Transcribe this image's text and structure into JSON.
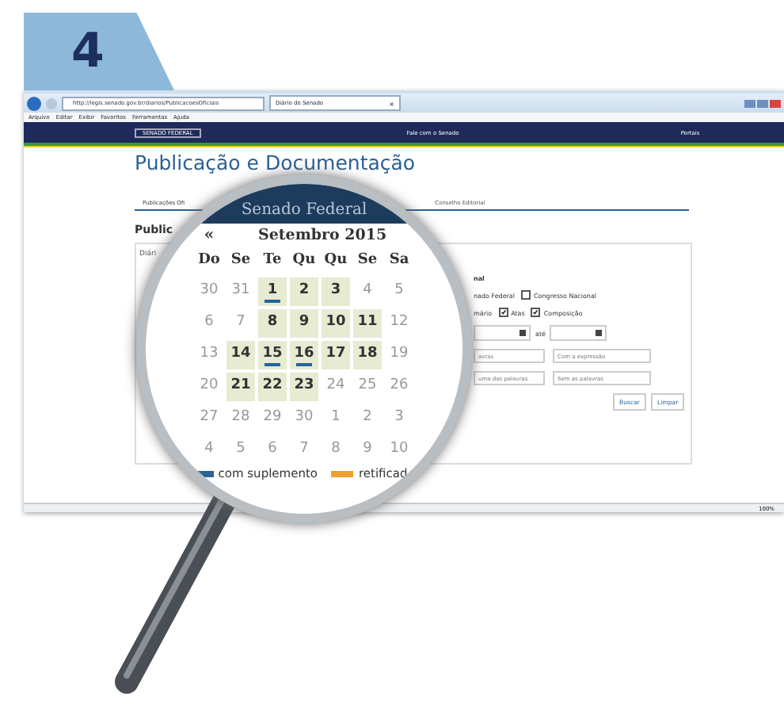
{
  "step": {
    "number": "4"
  },
  "browser": {
    "address": "http://legis.senado.gov.br/diarios/PublicacoesOficiais",
    "tab": {
      "title": "Diário do Senado",
      "close": "×"
    },
    "menu": [
      "Arquivo",
      "Editar",
      "Exibir",
      "Favoritos",
      "Ferramentas",
      "Ajuda"
    ],
    "zoom": "100%"
  },
  "site_header": {
    "brand": "SENADO FEDERAL",
    "contact": "Fale com o Senado",
    "portals": "Portais"
  },
  "page": {
    "title": "Publicação e Documentação",
    "nav": [
      {
        "label": "Publicações Ofi",
        "selected": true
      },
      {
        "label": "Conselho Editorial",
        "selected": false
      }
    ],
    "heading": "Public",
    "panel_title": "Diári",
    "form": {
      "group_label": "nal",
      "checkbox_rows": [
        [
          {
            "label": "nado Federal",
            "kind": "text"
          },
          {
            "label": "Congresso Nacional",
            "kind": "checkbox",
            "checked": false
          }
        ],
        [
          {
            "label": "mário",
            "kind": "text"
          },
          {
            "label": "Atas",
            "kind": "checkbox",
            "checked": true
          },
          {
            "label": "Composição",
            "kind": "checkbox",
            "checked": true
          }
        ]
      ],
      "date_separator": "até",
      "text_fields": [
        [
          {
            "placeholder": "avras"
          },
          {
            "placeholder": "Com a expressão"
          }
        ],
        [
          {
            "placeholder": "uma das palavras"
          },
          {
            "placeholder": "Sem as palavras"
          }
        ]
      ],
      "buttons": [
        "Buscar",
        "Limpar"
      ]
    }
  },
  "magnifier": {
    "band": "Senado Federal",
    "prev": "«",
    "month": "Setembro 2015",
    "weekdays": [
      "Do",
      "Se",
      "Te",
      "Qu",
      "Qu",
      "Se",
      "Sa"
    ],
    "weeks": [
      [
        {
          "day": "30",
          "published": false,
          "supplement": false
        },
        {
          "day": "31",
          "published": false,
          "supplement": false
        },
        {
          "day": "1",
          "published": true,
          "supplement": true
        },
        {
          "day": "2",
          "published": true,
          "supplement": false
        },
        {
          "day": "3",
          "published": true,
          "supplement": false
        },
        {
          "day": "4",
          "published": false,
          "supplement": false
        },
        {
          "day": "5",
          "published": false,
          "supplement": false
        }
      ],
      [
        {
          "day": "6",
          "published": false,
          "supplement": false
        },
        {
          "day": "7",
          "published": false,
          "supplement": false
        },
        {
          "day": "8",
          "published": true,
          "supplement": false
        },
        {
          "day": "9",
          "published": true,
          "supplement": false
        },
        {
          "day": "10",
          "published": true,
          "supplement": false
        },
        {
          "day": "11",
          "published": true,
          "supplement": false
        },
        {
          "day": "12",
          "published": false,
          "supplement": false
        }
      ],
      [
        {
          "day": "13",
          "published": false,
          "supplement": false
        },
        {
          "day": "14",
          "published": true,
          "supplement": false
        },
        {
          "day": "15",
          "published": true,
          "supplement": true
        },
        {
          "day": "16",
          "published": true,
          "supplement": true
        },
        {
          "day": "17",
          "published": true,
          "supplement": false
        },
        {
          "day": "18",
          "published": true,
          "supplement": false
        },
        {
          "day": "19",
          "published": false,
          "supplement": false
        }
      ],
      [
        {
          "day": "20",
          "published": false,
          "supplement": false
        },
        {
          "day": "21",
          "published": true,
          "supplement": false
        },
        {
          "day": "22",
          "published": true,
          "supplement": false
        },
        {
          "day": "23",
          "published": true,
          "supplement": false
        },
        {
          "day": "24",
          "published": false,
          "supplement": false
        },
        {
          "day": "25",
          "published": false,
          "supplement": false
        },
        {
          "day": "26",
          "published": false,
          "supplement": false
        }
      ],
      [
        {
          "day": "27",
          "published": false,
          "supplement": false
        },
        {
          "day": "28",
          "published": false,
          "supplement": false
        },
        {
          "day": "29",
          "published": false,
          "supplement": false
        },
        {
          "day": "30",
          "published": false,
          "supplement": false
        },
        {
          "day": "1",
          "published": false,
          "supplement": false
        },
        {
          "day": "2",
          "published": false,
          "supplement": false
        },
        {
          "day": "3",
          "published": false,
          "supplement": false
        }
      ],
      [
        {
          "day": "4",
          "published": false,
          "supplement": false
        },
        {
          "day": "5",
          "published": false,
          "supplement": false
        },
        {
          "day": "6",
          "published": false,
          "supplement": false
        },
        {
          "day": "7",
          "published": false,
          "supplement": false
        },
        {
          "day": "8",
          "published": false,
          "supplement": false
        },
        {
          "day": "9",
          "published": false,
          "supplement": false
        },
        {
          "day": "10",
          "published": false,
          "supplement": false
        }
      ]
    ],
    "legend": [
      {
        "label": "com suplemento",
        "color": "#2a6496"
      },
      {
        "label": "retificad",
        "color": "#f0a030"
      }
    ]
  }
}
